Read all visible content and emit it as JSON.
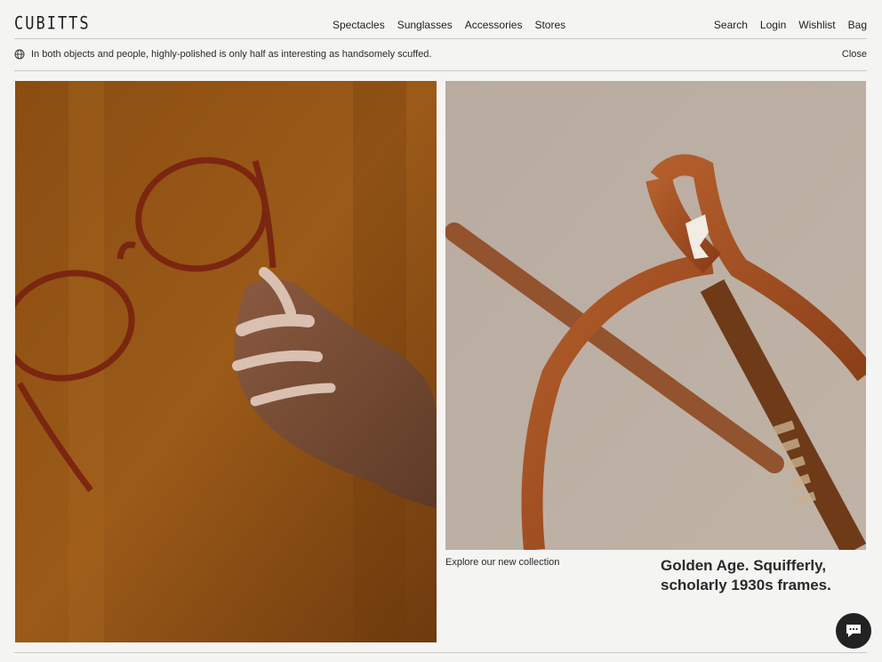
{
  "brand": {
    "logo": "CUBITTS"
  },
  "nav": {
    "items": [
      "Spectacles",
      "Sunglasses",
      "Accessories",
      "Stores"
    ]
  },
  "utils": {
    "search": "Search",
    "login": "Login",
    "wishlist": "Wishlist",
    "bag": "Bag"
  },
  "announcement": {
    "message": "In both objects and people, highly-polished is only half as interesting as handsomely scuffed.",
    "close": "Close"
  },
  "hero": {
    "left_image": "hand holding tortoiseshell glasses",
    "right_image": "close-up of amber spectacle frame",
    "cta": "Explore our new collection",
    "headline": "Golden Age. Squifferly, scholarly 1930s frames."
  },
  "chat": {
    "icon": "chat-bubble-icon"
  },
  "colors": {
    "background": "#f4f4f2",
    "text": "#1e1e1e",
    "divider": "#c9c9c6"
  }
}
